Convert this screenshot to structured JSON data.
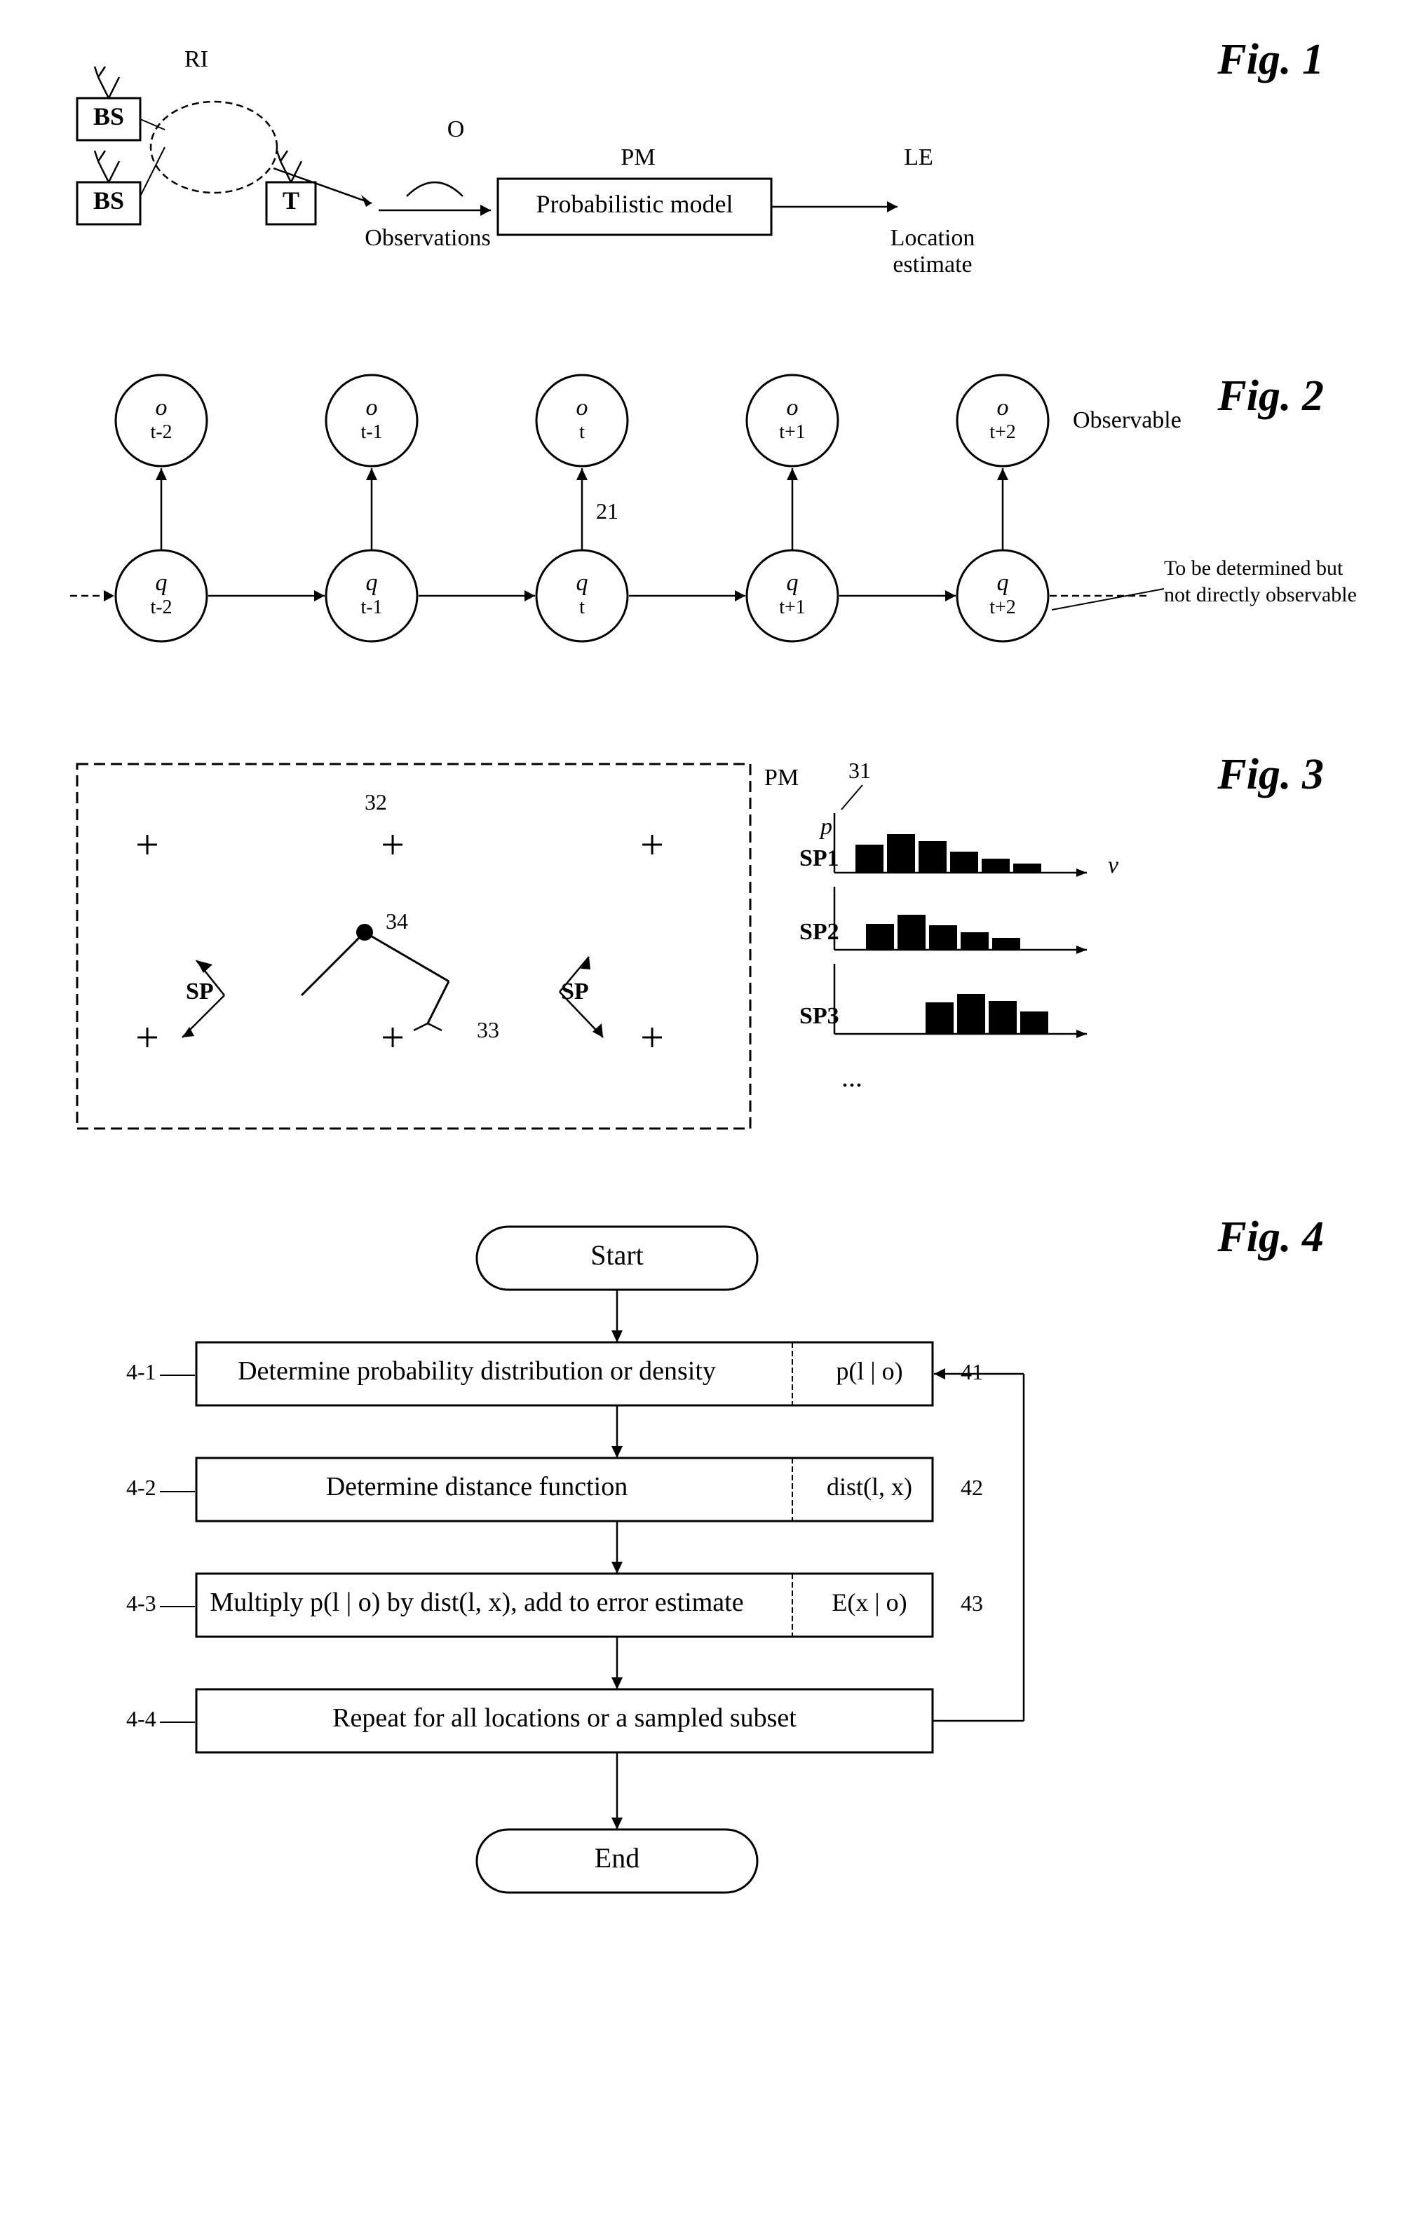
{
  "figures": {
    "fig1": {
      "label": "Fig. 1",
      "elements": {
        "bs1": "BS",
        "bs2": "BS",
        "t": "T",
        "ri": "RI",
        "o_label": "O",
        "observations": "Observations",
        "pm_label": "PM",
        "prob_model": "Probabilistic model",
        "le_label": "LE",
        "location_estimate": "Location\nestimate"
      }
    },
    "fig2": {
      "label": "Fig. 2",
      "nodes": [
        "o_{t-2}",
        "o_{t-1}",
        "o_t",
        "o_{t+1}",
        "o_{t+2}"
      ],
      "state_nodes": [
        "q_{t-2}",
        "q_{t-1}",
        "q_t",
        "q_{t+1}",
        "q_{t+2}"
      ],
      "observable_label": "Observable",
      "not_observable_label": "To be determined but\nnot directly observable",
      "ref_num": "21"
    },
    "fig3": {
      "label": "Fig. 3",
      "pm_label": "PM",
      "sp_label": "SP",
      "ref_nums": [
        "31",
        "32",
        "33",
        "34"
      ],
      "sp_items": [
        "SP1",
        "SP2",
        "SP3"
      ],
      "p_label": "p",
      "v_label": "v",
      "ellipsis": "..."
    },
    "fig4": {
      "label": "Fig. 4",
      "start": "Start",
      "end": "End",
      "steps": [
        {
          "id": "4-1",
          "label": "Determine probability distribution or density",
          "formula": "p(l | o)",
          "ref": "41"
        },
        {
          "id": "4-2",
          "label": "Determine distance function",
          "formula": "dist(l, x)",
          "ref": "42"
        },
        {
          "id": "4-3",
          "label": "Multiply p(l | o) by dist(l, x), add to error estimate",
          "formula": "E(x | o)",
          "ref": "43"
        },
        {
          "id": "4-4",
          "label": "Repeat for all locations or a sampled subset",
          "formula": "",
          "ref": ""
        }
      ]
    }
  }
}
